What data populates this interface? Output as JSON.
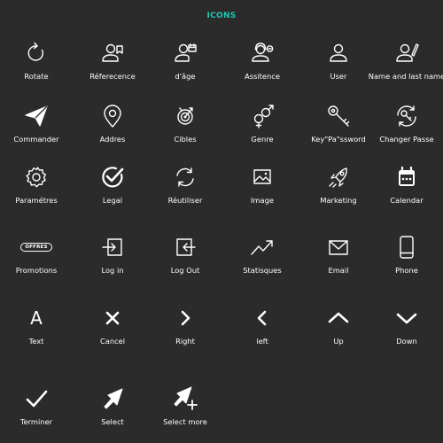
{
  "header": {
    "title": "ICONS"
  },
  "items": [
    {
      "label": "Rotate",
      "icon": "rotate-icon"
    },
    {
      "label": "Réferecence",
      "icon": "user-reference-icon"
    },
    {
      "label": "d'âge",
      "icon": "user-calendar-icon"
    },
    {
      "label": "Assitence",
      "icon": "user-headset-icon"
    },
    {
      "label": "User",
      "icon": "user-icon"
    },
    {
      "label": "Name and last name",
      "icon": "user-edit-icon"
    },
    {
      "label": "Commander",
      "icon": "paper-plane-icon"
    },
    {
      "label": "Addres",
      "icon": "map-pin-icon"
    },
    {
      "label": "Cibles",
      "icon": "target-icon"
    },
    {
      "label": "Genre",
      "icon": "gender-icon"
    },
    {
      "label": "Key\"Pa\"ssword",
      "icon": "key-icon"
    },
    {
      "label": "Changer Passe",
      "icon": "key-refresh-icon"
    },
    {
      "label": "Paramétres",
      "icon": "gear-icon"
    },
    {
      "label": "Legal",
      "icon": "check-circle-icon"
    },
    {
      "label": "Réutiliser",
      "icon": "reuse-arrows-icon"
    },
    {
      "label": "Image",
      "icon": "image-icon"
    },
    {
      "label": "Marketing",
      "icon": "rocket-icon"
    },
    {
      "label": "Calendar",
      "icon": "calendar-icon"
    },
    {
      "label": "Promotions",
      "icon": "offers-badge-icon",
      "badge": "OFFRES"
    },
    {
      "label": "Log in",
      "icon": "log-in-icon"
    },
    {
      "label": "Log Out",
      "icon": "log-out-icon"
    },
    {
      "label": "Statisques",
      "icon": "trend-up-icon"
    },
    {
      "label": "Email",
      "icon": "envelope-icon"
    },
    {
      "label": "Phone",
      "icon": "phone-icon"
    },
    {
      "label": "Text",
      "icon": "text-a-icon",
      "glyph": "A"
    },
    {
      "label": "Cancel",
      "icon": "close-icon"
    },
    {
      "label": "Right",
      "icon": "chevron-right-icon"
    },
    {
      "label": "left",
      "icon": "chevron-left-icon"
    },
    {
      "label": "Up",
      "icon": "chevron-up-icon"
    },
    {
      "label": "Down",
      "icon": "chevron-down-icon"
    },
    {
      "label": "Terminer",
      "icon": "checkmark-icon"
    },
    {
      "label": "Select",
      "icon": "cursor-arrow-icon"
    },
    {
      "label": "Select more",
      "icon": "cursor-arrow-plus-icon"
    }
  ]
}
